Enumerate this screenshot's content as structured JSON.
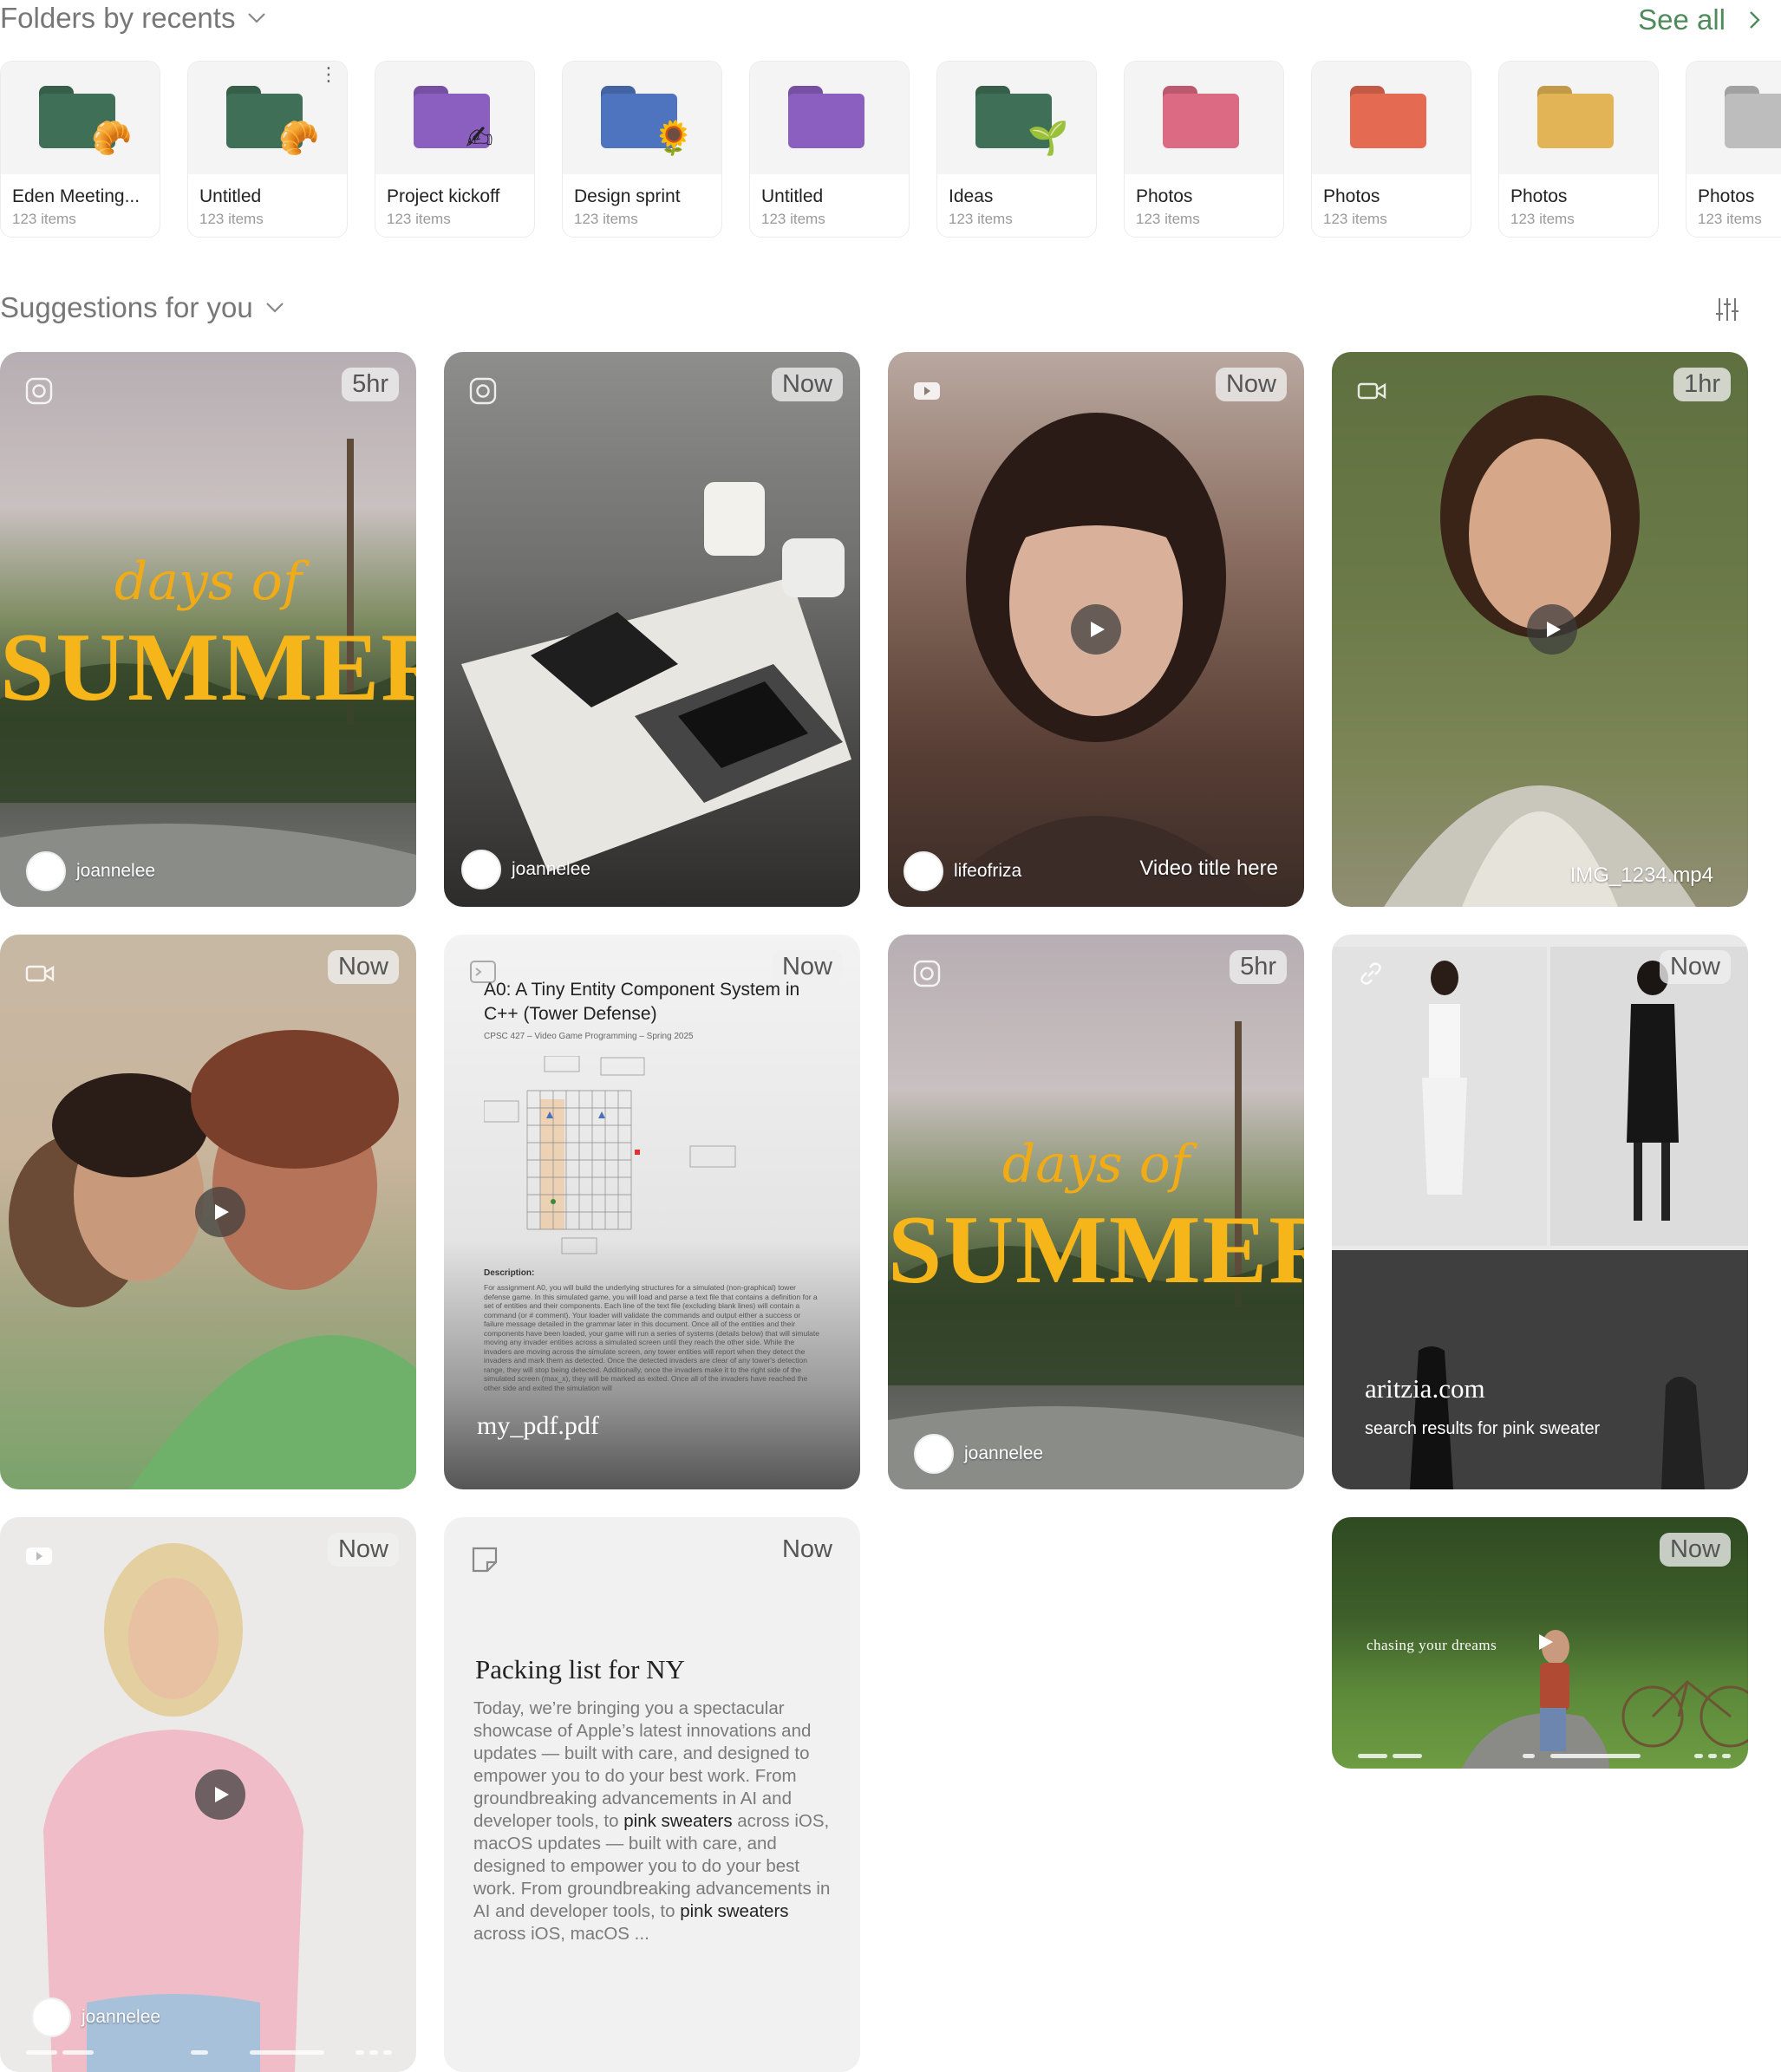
{
  "folders_section": {
    "title": "Folders by recents",
    "see_all": "See all",
    "items": [
      {
        "name": "Eden Meeting...",
        "count": "123 items",
        "color": "#3f6f56",
        "deco": "🥐"
      },
      {
        "name": "Untitled",
        "count": "123 items",
        "color": "#3f6f56",
        "deco": "🥐"
      },
      {
        "name": "Project kickoff",
        "count": "123 items",
        "color": "#8b5fc0",
        "deco": "✍"
      },
      {
        "name": "Design sprint",
        "count": "123 items",
        "color": "#4f74bf",
        "deco": "🌻"
      },
      {
        "name": "Untitled",
        "count": "123 items",
        "color": "#8b5fc0",
        "deco": ""
      },
      {
        "name": "Ideas",
        "count": "123 items",
        "color": "#3f6f56",
        "deco": "🌱"
      },
      {
        "name": "Photos",
        "count": "123 items",
        "color": "#dc6a82",
        "deco": ""
      },
      {
        "name": "Photos",
        "count": "123 items",
        "color": "#e46a52",
        "deco": ""
      },
      {
        "name": "Photos",
        "count": "123 items",
        "color": "#e3b456",
        "deco": ""
      },
      {
        "name": "Photos",
        "count": "123 items",
        "color": "#bdbdbd",
        "deco": ""
      }
    ]
  },
  "suggestions_section": {
    "title": "Suggestions for you"
  },
  "cards": {
    "c1": {
      "time": "5hr",
      "user": "joannelee",
      "days": "days of",
      "big": "SUMMER",
      "source": "instagram-icon"
    },
    "c2": {
      "time": "Now",
      "user": "joannelee",
      "source": "instagram-icon"
    },
    "c3": {
      "time": "Now",
      "user": "lifeofriza",
      "caption": "Video title here",
      "source": "youtube-icon"
    },
    "c4": {
      "time": "1hr",
      "caption": "IMG_1234.mp4",
      "source": "video-camera-icon"
    },
    "c5": {
      "time": "Now",
      "source": "video-camera-icon"
    },
    "c6": {
      "time": "Now",
      "pdf_title": "A0: A Tiny Entity Component System in C++ (Tower Defense)",
      "pdf_sub": "CPSC 427 – Video Game Programming – Spring 2025",
      "pdf_desc_head": "Description:",
      "pdf_text": "For assignment A0, you will build the underlying structures for a simulated (non-graphical) tower defense game. In this simulated game, you will load and parse a text file that contains a definition for a set of entities and their components. Each line of the text file (excluding blank lines) will contain a command (or # comment). Your loader will validate the commands and output either a success or failure message detailed in the grammar later in this document. Once all of the entities and their components have been loaded, your game will run a series of systems (details below) that will simulate moving any invader entities across a simulated screen until they reach the other side. While the invaders are moving across the simulate screen, any tower entities will report when they detect the invaders and mark them as detected. Once the detected invaders are clear of any tower's detection range, they will stop being detected. Additionally, once the invaders make it to the right side of the simulated screen (max_x), they will be marked as exited. Once all of the invaders have reached the other side and exited the simulation will",
      "file": "my_pdf.pdf",
      "source": "terminal-icon"
    },
    "c7": {
      "time": "5hr",
      "user": "joannelee",
      "days": "days of",
      "big": "SUMMER",
      "source": "instagram-icon"
    },
    "c8": {
      "time": "Now",
      "site": "aritzia.com",
      "sub": "search results for pink sweater",
      "source": "link-icon"
    },
    "c9": {
      "time": "Now",
      "user": "joannelee",
      "source": "youtube-icon"
    },
    "c10": {
      "time": "Now",
      "title": "Packing list for NY",
      "body_1": "Today, we’re bringing you a spectacular showcase of Apple’s latest innovations and updates — built with care, and designed to empower you to do your best work. From groundbreaking advancements in AI and developer tools, to ",
      "hl_1": "pink sweaters",
      "body_2": " across iOS, macOS updates — built with care, and designed to empower you to do your best work. From groundbreaking advancements in AI and developer tools, to ",
      "hl_2": "pink sweaters",
      "body_3": " across iOS, macOS ...",
      "source": "note-icon"
    },
    "c11": {
      "time": "Now",
      "caption": "chasing your dreams"
    }
  },
  "colors": {
    "accent": "#4f8a5b",
    "summer_yellow": "#f6b619"
  }
}
